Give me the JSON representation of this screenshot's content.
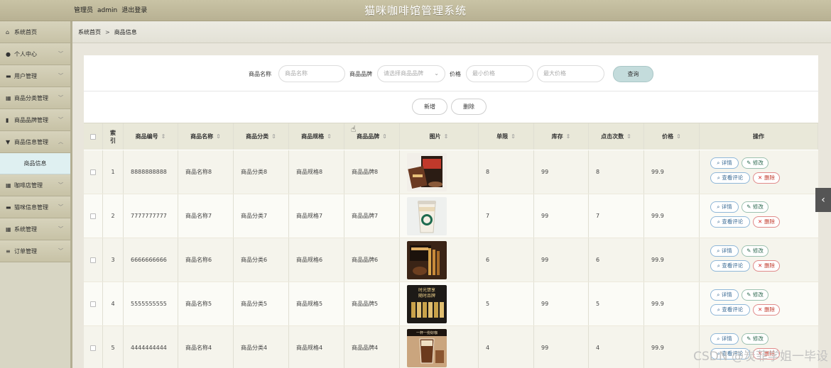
{
  "header": {
    "user_label": "管理员",
    "username": "admin",
    "logout": "退出登录",
    "app_title": "猫咪咖啡馆管理系统"
  },
  "sidebar": {
    "items": [
      {
        "label": "系统首页",
        "icon": "home-icon",
        "glyph": "⌂",
        "expandable": false
      },
      {
        "label": "个人中心",
        "icon": "user-icon",
        "glyph": "●",
        "expandable": true
      },
      {
        "label": "用户管理",
        "icon": "user-group-icon",
        "glyph": "▬",
        "expandable": true
      },
      {
        "label": "商品分类管理",
        "icon": "grid-icon",
        "glyph": "▦",
        "expandable": true
      },
      {
        "label": "商品品牌管理",
        "icon": "bookmark-icon",
        "glyph": "▮",
        "expandable": true
      },
      {
        "label": "商品信息管理",
        "icon": "pin-icon",
        "glyph": "▼",
        "expandable": true,
        "open": true
      }
    ],
    "active_sub": "商品信息",
    "items_after": [
      {
        "label": "咖啡店管理",
        "icon": "grid-icon",
        "glyph": "▦",
        "expandable": true
      },
      {
        "label": "猫咪信息管理",
        "icon": "card-icon",
        "glyph": "▬",
        "expandable": true
      },
      {
        "label": "系统管理",
        "icon": "grid-icon",
        "glyph": "▦",
        "expandable": true
      },
      {
        "label": "订单管理",
        "icon": "list-icon",
        "glyph": "≡",
        "expandable": true
      }
    ]
  },
  "breadcrumb": {
    "home": "系统首页",
    "separator": ">",
    "current": "商品信息"
  },
  "search": {
    "name_label": "商品名称",
    "name_placeholder": "商品名称",
    "brand_label": "商品品牌",
    "brand_placeholder": "请选择商品品牌",
    "price_label": "价格",
    "min_price_placeholder": "最小价格",
    "max_price_placeholder": "最大价格",
    "query_button": "查询"
  },
  "actions": {
    "add": "新增",
    "delete": "删除"
  },
  "table": {
    "headers": [
      "索引",
      "商品编号",
      "商品名称",
      "商品分类",
      "商品规格",
      "商品品牌",
      "图片",
      "单限",
      "库存",
      "点击次数",
      "价格",
      "操作"
    ],
    "index_header_line1": "索",
    "index_header_line2": "引",
    "sort_glyph": "⇕",
    "rows": [
      {
        "idx": "1",
        "code": "8888888888",
        "name": "商品名称8",
        "category": "商品分类8",
        "spec": "商品规格8",
        "brand": "商品品牌8",
        "limit": "8",
        "stock": "99",
        "clicks": "8",
        "price": "99.9",
        "image": "coffee-box"
      },
      {
        "idx": "2",
        "code": "7777777777",
        "name": "商品名称7",
        "category": "商品分类7",
        "spec": "商品规格7",
        "brand": "商品品牌7",
        "limit": "7",
        "stock": "99",
        "clicks": "7",
        "price": "99.9",
        "image": "starbucks-cup"
      },
      {
        "idx": "3",
        "code": "6666666666",
        "name": "商品名称6",
        "category": "商品分类6",
        "spec": "商品规格6",
        "brand": "商品品牌6",
        "limit": "6",
        "stock": "99",
        "clicks": "6",
        "price": "99.9",
        "image": "coffee-sticks"
      },
      {
        "idx": "4",
        "code": "5555555555",
        "name": "商品名称5",
        "category": "商品分类5",
        "spec": "商品规格5",
        "brand": "商品品牌5",
        "limit": "5",
        "stock": "99",
        "clicks": "5",
        "price": "99.9",
        "image": "coffee-poster",
        "image_text_1": "时光馈享",
        "image_text_2": "随时品牌"
      },
      {
        "idx": "5",
        "code": "4444444444",
        "name": "商品名称4",
        "category": "商品分类4",
        "spec": "商品规格4",
        "brand": "商品品牌4",
        "limit": "4",
        "stock": "99",
        "clicks": "4",
        "price": "99.9",
        "image": "iced-coffee",
        "image_text_1": "一杯一份好咖"
      }
    ],
    "op_buttons": {
      "detail": "详情",
      "edit": "修改",
      "reviews": "查看评论",
      "delete": "删除"
    }
  },
  "watermark": "CSDN @炭菲学姐一毕设",
  "colors": {
    "header": "#c4bea0",
    "sidebar": "#d8d6c4",
    "active_sub": "#dff0f1",
    "table_head": "#e9e8d9",
    "query_button": "#c4dcdc",
    "delete_accent": "#d62b2b"
  }
}
